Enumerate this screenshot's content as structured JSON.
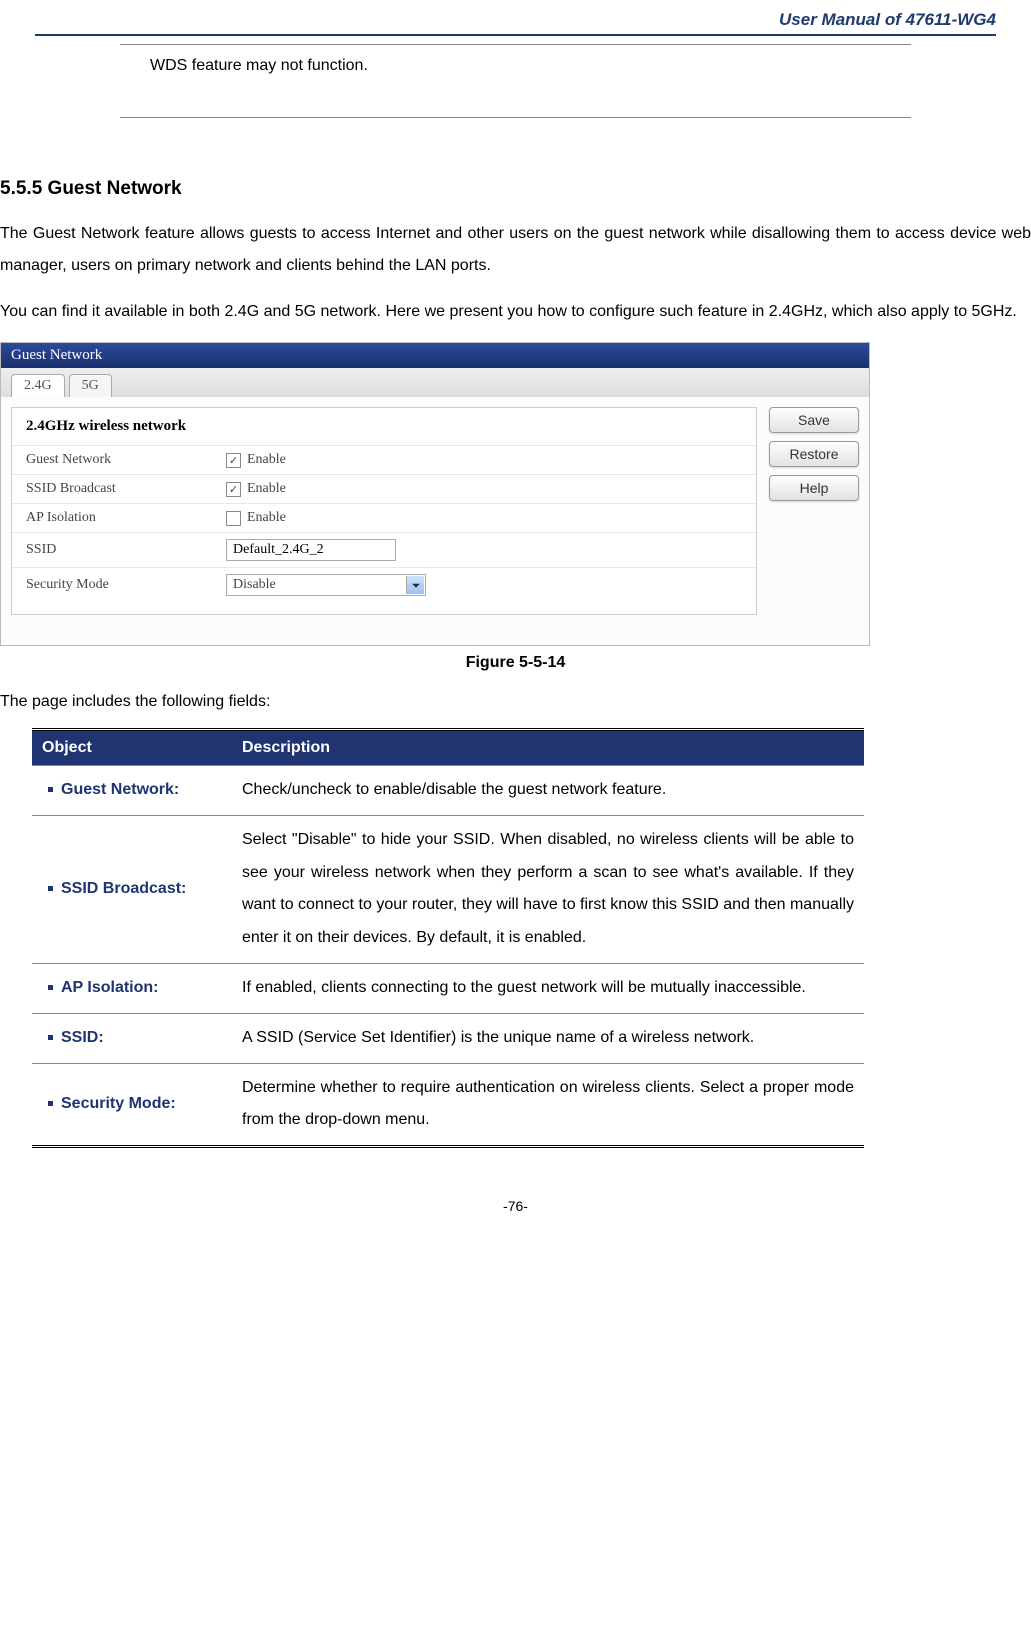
{
  "header": {
    "title": "User Manual of 47611-WG4"
  },
  "callout": {
    "text": "WDS feature may not function."
  },
  "section": {
    "heading": "5.5.5   Guest Network"
  },
  "paragraphs": {
    "p1": "The Guest Network feature allows guests to access Internet and other users on the guest network while disallowing them to access device web manager, users on primary network and clients behind the LAN ports.",
    "p2": "You can find it available in both 2.4G and 5G network. Here we present you how to configure such feature in 2.4GHz, which also apply to 5GHz."
  },
  "ui": {
    "window_title": "Guest Network",
    "tabs": {
      "t1": "2.4G",
      "t2": "5G"
    },
    "form_heading": "2.4GHz wireless network",
    "rows": {
      "guest_network": {
        "label": "Guest Network",
        "enable": "Enable",
        "checked": true
      },
      "ssid_broadcast": {
        "label": "SSID Broadcast",
        "enable": "Enable",
        "checked": true
      },
      "ap_isolation": {
        "label": "AP Isolation",
        "enable": "Enable",
        "checked": false
      },
      "ssid": {
        "label": "SSID",
        "value": "Default_2.4G_2"
      },
      "security": {
        "label": "Security Mode",
        "value": "Disable"
      }
    },
    "buttons": {
      "save": "Save",
      "restore": "Restore",
      "help": "Help"
    }
  },
  "figure_caption": "Figure 5-5-14",
  "intro_fields": "The page includes the following fields:",
  "table": {
    "head": {
      "object": "Object",
      "description": "Description"
    },
    "rows": {
      "r1": {
        "obj": "Guest Network:",
        "desc": "Check/uncheck to enable/disable the guest network feature."
      },
      "r2": {
        "obj": "SSID Broadcast:",
        "desc": "Select \"Disable\" to hide your SSID. When disabled, no wireless clients will be able to see your wireless network when they perform a scan to see what's available. If they want to connect to your router, they will have to first know this SSID and then manually enter it on their devices. By default, it is enabled."
      },
      "r3": {
        "obj": "AP Isolation:",
        "desc": "If enabled, clients connecting to the guest network will be mutually inaccessible."
      },
      "r4": {
        "obj": "SSID:",
        "desc": "A SSID (Service Set Identifier) is the unique name of a wireless network."
      },
      "r5": {
        "obj": "Security Mode:",
        "desc": "Determine whether to require authentication on wireless clients. Select a proper mode from the drop-down menu."
      }
    }
  },
  "page_number": "-76-"
}
